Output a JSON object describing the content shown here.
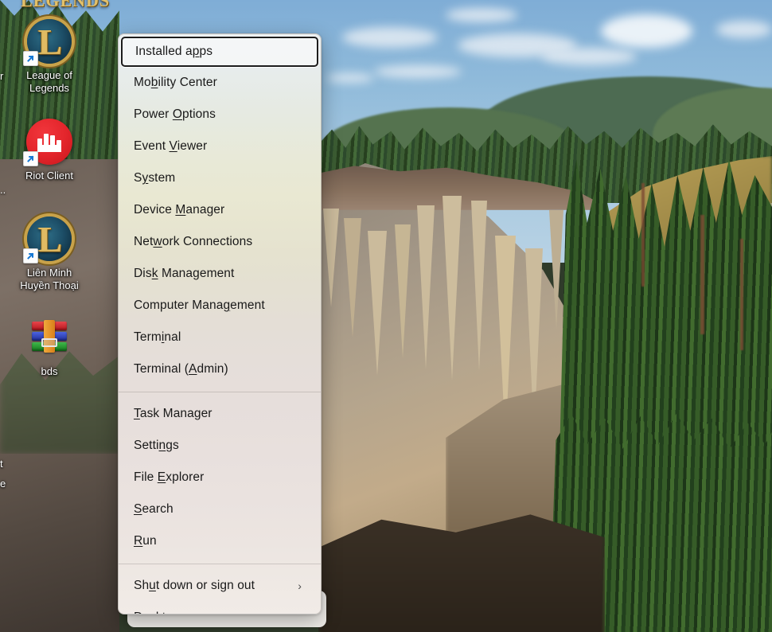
{
  "window": {
    "type": "windows-quick-link-menu",
    "title": "Win+X Quick Link menu"
  },
  "menu": {
    "groups": [
      {
        "items": [
          {
            "label": "Installed apps",
            "pre": "Installed a",
            "accel": "p",
            "post": "ps",
            "focused": true,
            "submenu": false
          },
          {
            "label": "Mobility Center",
            "pre": "Mo",
            "accel": "b",
            "post": "ility Center",
            "focused": false,
            "submenu": false
          },
          {
            "label": "Power Options",
            "pre": "Power ",
            "accel": "O",
            "post": "ptions",
            "focused": false,
            "submenu": false
          },
          {
            "label": "Event Viewer",
            "pre": "Event ",
            "accel": "V",
            "post": "iewer",
            "focused": false,
            "submenu": false
          },
          {
            "label": "System",
            "pre": "S",
            "accel": "y",
            "post": "stem",
            "focused": false,
            "submenu": false
          },
          {
            "label": "Device Manager",
            "pre": "Device ",
            "accel": "M",
            "post": "anager",
            "focused": false,
            "submenu": false
          },
          {
            "label": "Network Connections",
            "pre": "Net",
            "accel": "w",
            "post": "ork Connections",
            "focused": false,
            "submenu": false
          },
          {
            "label": "Disk Management",
            "pre": "Dis",
            "accel": "k",
            "post": " Management",
            "focused": false,
            "submenu": false
          },
          {
            "label": "Computer Management",
            "pre": "Computer Mana",
            "accel": "g",
            "post": "ement",
            "focused": false,
            "submenu": false
          },
          {
            "label": "Terminal",
            "pre": "Term",
            "accel": "i",
            "post": "nal",
            "focused": false,
            "submenu": false
          },
          {
            "label": "Terminal (Admin)",
            "pre": "Terminal (",
            "accel": "A",
            "post": "dmin)",
            "focused": false,
            "submenu": false
          }
        ]
      },
      {
        "items": [
          {
            "label": "Task Manager",
            "pre": "",
            "accel": "T",
            "post": "ask Manager",
            "focused": false,
            "submenu": false
          },
          {
            "label": "Settings",
            "pre": "Setti",
            "accel": "n",
            "post": "gs",
            "focused": false,
            "submenu": false
          },
          {
            "label": "File Explorer",
            "pre": "File ",
            "accel": "E",
            "post": "xplorer",
            "focused": false,
            "submenu": false
          },
          {
            "label": "Search",
            "pre": "",
            "accel": "S",
            "post": "earch",
            "focused": false,
            "submenu": false
          },
          {
            "label": "Run",
            "pre": "",
            "accel": "R",
            "post": "un",
            "focused": false,
            "submenu": false
          }
        ]
      },
      {
        "items": [
          {
            "label": "Shut down or sign out",
            "pre": "Sh",
            "accel": "u",
            "post": "t down or sign out",
            "focused": false,
            "submenu": true,
            "chevron": "›"
          },
          {
            "label": "Desktop",
            "pre": "",
            "accel": "D",
            "post": "esktop",
            "focused": false,
            "submenu": false
          }
        ]
      }
    ]
  },
  "desktop": {
    "icons": [
      {
        "name": "League of Legends",
        "label_line1": "League of",
        "label_line2": "Legends",
        "kind": "lol-shortcut"
      },
      {
        "name": "Riot Client",
        "label_line1": "Riot Client",
        "label_line2": "",
        "kind": "riot-shortcut"
      },
      {
        "name": "Liên Minh Huyền Thoại",
        "label_line1": "Liên Minh",
        "label_line2": "Huyền Thoại",
        "kind": "lol-shortcut"
      },
      {
        "name": "bds",
        "label_line1": "bds",
        "label_line2": "",
        "kind": "winrar-archive"
      }
    ],
    "edge_fragments": [
      {
        "text": "r",
        "name": "clipped-icon-label-r"
      },
      {
        "text": "..",
        "name": "clipped-icon-label-dots"
      },
      {
        "text": "t",
        "name": "clipped-icon-label-t"
      },
      {
        "text": "e",
        "name": "clipped-icon-label-e"
      }
    ],
    "top_fragment": {
      "text": "LEGENDS",
      "name": "clipped-wordmark"
    },
    "wallpaper": {
      "description": "Pinnacles volcanic spires canyon with conifer forest and blue sky",
      "sky_color": "#8fbada",
      "rock_color": "#b5a58d",
      "forest_color": "#2d4a2c"
    }
  },
  "colors": {
    "menu_text": "#191919",
    "focus_border": "#1d1d1d",
    "separator": "rgba(120,115,112,.28)"
  }
}
